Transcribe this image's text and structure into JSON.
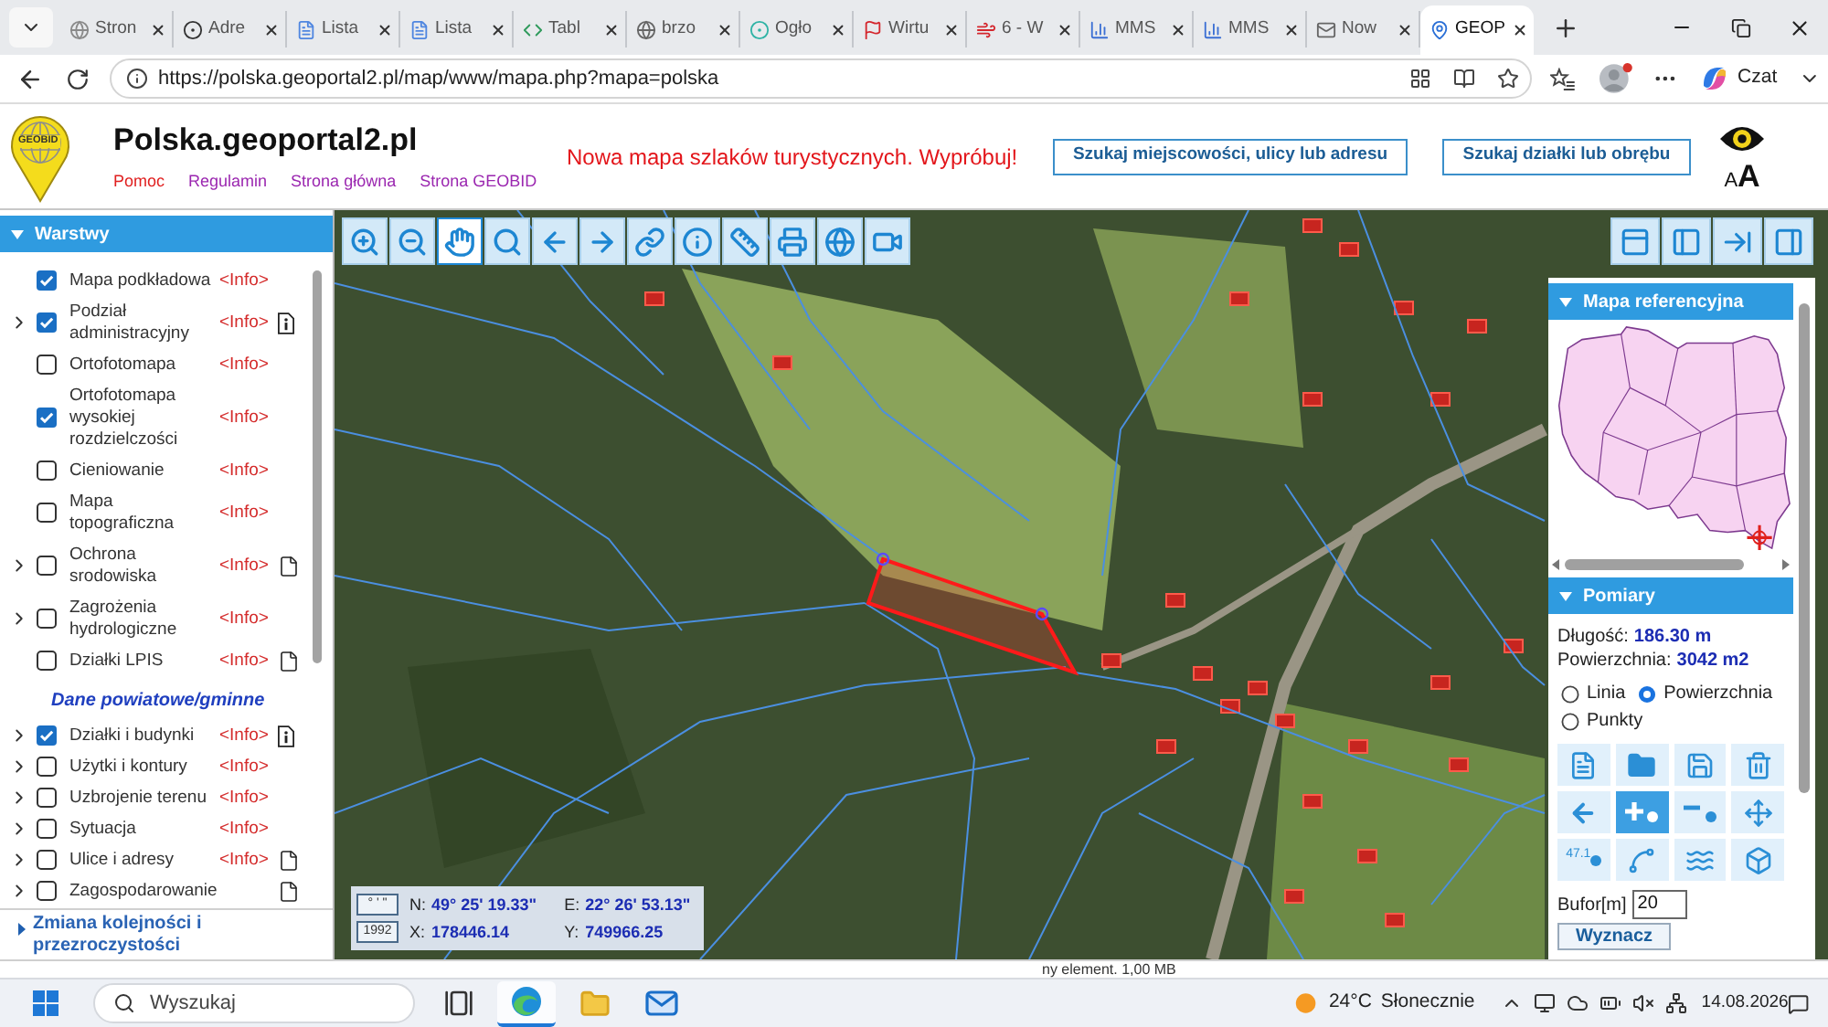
{
  "browser": {
    "tabs": [
      {
        "title": "Stron",
        "selected": false
      },
      {
        "title": "Adre",
        "selected": false
      },
      {
        "title": "Lista",
        "selected": false
      },
      {
        "title": "Lista",
        "selected": false
      },
      {
        "title": "Tabl",
        "selected": false
      },
      {
        "title": "brzo",
        "selected": false
      },
      {
        "title": "Ogło",
        "selected": false
      },
      {
        "title": "Wirtu",
        "selected": false
      },
      {
        "title": "6 - W",
        "selected": false
      },
      {
        "title": "MMS",
        "selected": false
      },
      {
        "title": "MMS",
        "selected": false
      },
      {
        "title": "Now",
        "selected": false
      },
      {
        "title": "GEOP",
        "selected": true
      }
    ],
    "address": "https://polska.geoportal2.pl/map/www/mapa.php?mapa=polska",
    "chat_button": "Czat"
  },
  "header": {
    "logo_text": "GEOBID",
    "site_title": "Polska.geoportal2.pl",
    "links": [
      {
        "label": "Pomoc",
        "color": "#e02020"
      },
      {
        "label": "Regulamin",
        "color": "#9b27b0"
      },
      {
        "label": "Strona główna",
        "color": "#9b27b0"
      },
      {
        "label": "Strona GEOBID",
        "color": "#9b27b0"
      }
    ],
    "announcement": "Nowa mapa szlaków turystycznych. Wypróbuj!",
    "search_buttons": [
      "Szukaj miejscowości, ulicy lub adresu",
      "Szukaj działki lub obrębu"
    ],
    "text_size": [
      "A",
      "A"
    ]
  },
  "layers_panel": {
    "title": "Warstwy",
    "items": [
      {
        "kind": "layer",
        "label": "Mapa podkładowa",
        "checked": true,
        "expandable": false,
        "info": "<Info>",
        "info_sheet": false,
        "document": false
      },
      {
        "kind": "layer",
        "label": "Podział administracyjny",
        "checked": true,
        "expandable": true,
        "info": "<Info>",
        "info_sheet": true,
        "document": false
      },
      {
        "kind": "layer",
        "label": "Ortofotomapa",
        "checked": false,
        "expandable": false,
        "info": "<Info>",
        "info_sheet": false,
        "document": false
      },
      {
        "kind": "layer",
        "label": "Ortofotomapa wysokiej rozdzielczości",
        "checked": true,
        "expandable": false,
        "info": "<Info>",
        "info_sheet": false,
        "document": false
      },
      {
        "kind": "layer",
        "label": "Cieniowanie",
        "checked": false,
        "expandable": false,
        "info": "<Info>",
        "info_sheet": false,
        "document": false
      },
      {
        "kind": "layer",
        "label": "Mapa topograficzna",
        "checked": false,
        "expandable": false,
        "info": "<Info>",
        "info_sheet": false,
        "document": false
      },
      {
        "kind": "layer",
        "label": "Ochrona srodowiska",
        "checked": false,
        "expandable": true,
        "info": "<Info>",
        "info_sheet": false,
        "document": true
      },
      {
        "kind": "layer",
        "label": "Zagrożenia hydrologiczne",
        "checked": false,
        "expandable": true,
        "info": "<Info>",
        "info_sheet": false,
        "document": false
      },
      {
        "kind": "layer",
        "label": "Działki LPIS",
        "checked": false,
        "expandable": false,
        "info": "<Info>",
        "info_sheet": false,
        "document": true
      },
      {
        "kind": "heading",
        "label": "Dane powiatowe/gminne"
      },
      {
        "kind": "layer",
        "label": "Działki i budynki",
        "checked": true,
        "expandable": true,
        "info": "<Info>",
        "info_sheet": true,
        "document": false
      },
      {
        "kind": "layer",
        "label": "Użytki i kontury",
        "checked": false,
        "expandable": true,
        "info": "<Info>",
        "info_sheet": false,
        "document": false
      },
      {
        "kind": "layer",
        "label": "Uzbrojenie terenu",
        "checked": false,
        "expandable": true,
        "info": "<Info>",
        "info_sheet": false,
        "document": false
      },
      {
        "kind": "layer",
        "label": "Sytuacja",
        "checked": false,
        "expandable": true,
        "info": "<Info>",
        "info_sheet": false,
        "document": false
      },
      {
        "kind": "layer",
        "label": "Ulice i adresy",
        "checked": false,
        "expandable": true,
        "info": "<Info>",
        "info_sheet": false,
        "document": true
      },
      {
        "kind": "layer",
        "label": "Zagospodarowanie",
        "checked": false,
        "expandable": true,
        "info_sheet": false,
        "document": true
      }
    ],
    "footer_link": "Zmiana kolejności i przezroczystości"
  },
  "map": {
    "tools": [
      {
        "selected": false
      },
      {
        "selected": false
      },
      {
        "selected": true
      },
      {
        "selected": false
      },
      {
        "selected": false
      },
      {
        "selected": false
      },
      {
        "selected": false
      },
      {
        "selected": false
      },
      {
        "selected": false
      },
      {
        "selected": false
      },
      {
        "selected": false
      },
      {
        "selected": false
      }
    ],
    "coordinates": {
      "format_buttons": [
        "° ' \"",
        "1992"
      ],
      "fields": [
        {
          "label": "N:",
          "value": "49° 25' 19.33\""
        },
        {
          "label": "E:",
          "value": "22° 26' 53.13\""
        },
        {
          "label": "X:",
          "value": "178446.14"
        },
        {
          "label": "Y:",
          "value": "749966.25"
        }
      ]
    }
  },
  "side_panel": {
    "reference_map": {
      "title": "Mapa referencyjna"
    },
    "measurement": {
      "title": "Pomiary",
      "results": [
        {
          "label": "Długość:",
          "value": "186.30 m"
        },
        {
          "label": "Powierzchnia:",
          "value": "3042 m2"
        }
      ],
      "modes": [
        {
          "label": "Linia",
          "selected": false
        },
        {
          "label": "Powierzchnia",
          "selected": true
        },
        {
          "label": "Punkty",
          "selected": false
        }
      ],
      "tools": [
        {
          "selected": false
        },
        {
          "selected": false
        },
        {
          "selected": false
        },
        {
          "selected": false
        },
        {
          "selected": false
        },
        {
          "selected": true
        },
        {
          "selected": false
        },
        {
          "selected": false
        },
        {
          "selected": false,
          "label": "47.1"
        },
        {
          "selected": false
        },
        {
          "selected": false
        },
        {
          "selected": false
        }
      ],
      "buffer": {
        "label": "Bufor[m]",
        "value": "20"
      },
      "compute_button": "Wyznacz"
    }
  },
  "status_text": "ny element. 1,00 MB",
  "taskbar": {
    "search_placeholder": "Wyszukaj",
    "apps": [
      {
        "selected": false
      },
      {
        "selected": true
      },
      {
        "selected": false
      },
      {
        "selected": false
      }
    ],
    "weather": {
      "temperature": "24°C",
      "condition": "Słonecznie"
    },
    "date": "14.08.2026"
  }
}
